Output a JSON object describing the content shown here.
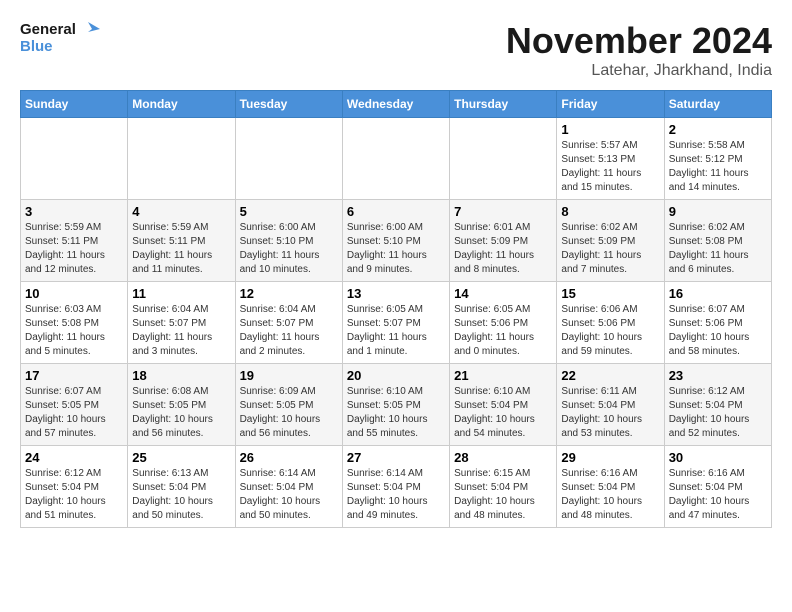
{
  "logo": {
    "line1": "General",
    "line2": "Blue"
  },
  "title": "November 2024",
  "location": "Latehar, Jharkhand, India",
  "days_of_week": [
    "Sunday",
    "Monday",
    "Tuesday",
    "Wednesday",
    "Thursday",
    "Friday",
    "Saturday"
  ],
  "weeks": [
    [
      {
        "day": "",
        "info": ""
      },
      {
        "day": "",
        "info": ""
      },
      {
        "day": "",
        "info": ""
      },
      {
        "day": "",
        "info": ""
      },
      {
        "day": "",
        "info": ""
      },
      {
        "day": "1",
        "info": "Sunrise: 5:57 AM\nSunset: 5:13 PM\nDaylight: 11 hours and 15 minutes."
      },
      {
        "day": "2",
        "info": "Sunrise: 5:58 AM\nSunset: 5:12 PM\nDaylight: 11 hours and 14 minutes."
      }
    ],
    [
      {
        "day": "3",
        "info": "Sunrise: 5:59 AM\nSunset: 5:11 PM\nDaylight: 11 hours and 12 minutes."
      },
      {
        "day": "4",
        "info": "Sunrise: 5:59 AM\nSunset: 5:11 PM\nDaylight: 11 hours and 11 minutes."
      },
      {
        "day": "5",
        "info": "Sunrise: 6:00 AM\nSunset: 5:10 PM\nDaylight: 11 hours and 10 minutes."
      },
      {
        "day": "6",
        "info": "Sunrise: 6:00 AM\nSunset: 5:10 PM\nDaylight: 11 hours and 9 minutes."
      },
      {
        "day": "7",
        "info": "Sunrise: 6:01 AM\nSunset: 5:09 PM\nDaylight: 11 hours and 8 minutes."
      },
      {
        "day": "8",
        "info": "Sunrise: 6:02 AM\nSunset: 5:09 PM\nDaylight: 11 hours and 7 minutes."
      },
      {
        "day": "9",
        "info": "Sunrise: 6:02 AM\nSunset: 5:08 PM\nDaylight: 11 hours and 6 minutes."
      }
    ],
    [
      {
        "day": "10",
        "info": "Sunrise: 6:03 AM\nSunset: 5:08 PM\nDaylight: 11 hours and 5 minutes."
      },
      {
        "day": "11",
        "info": "Sunrise: 6:04 AM\nSunset: 5:07 PM\nDaylight: 11 hours and 3 minutes."
      },
      {
        "day": "12",
        "info": "Sunrise: 6:04 AM\nSunset: 5:07 PM\nDaylight: 11 hours and 2 minutes."
      },
      {
        "day": "13",
        "info": "Sunrise: 6:05 AM\nSunset: 5:07 PM\nDaylight: 11 hours and 1 minute."
      },
      {
        "day": "14",
        "info": "Sunrise: 6:05 AM\nSunset: 5:06 PM\nDaylight: 11 hours and 0 minutes."
      },
      {
        "day": "15",
        "info": "Sunrise: 6:06 AM\nSunset: 5:06 PM\nDaylight: 10 hours and 59 minutes."
      },
      {
        "day": "16",
        "info": "Sunrise: 6:07 AM\nSunset: 5:06 PM\nDaylight: 10 hours and 58 minutes."
      }
    ],
    [
      {
        "day": "17",
        "info": "Sunrise: 6:07 AM\nSunset: 5:05 PM\nDaylight: 10 hours and 57 minutes."
      },
      {
        "day": "18",
        "info": "Sunrise: 6:08 AM\nSunset: 5:05 PM\nDaylight: 10 hours and 56 minutes."
      },
      {
        "day": "19",
        "info": "Sunrise: 6:09 AM\nSunset: 5:05 PM\nDaylight: 10 hours and 56 minutes."
      },
      {
        "day": "20",
        "info": "Sunrise: 6:10 AM\nSunset: 5:05 PM\nDaylight: 10 hours and 55 minutes."
      },
      {
        "day": "21",
        "info": "Sunrise: 6:10 AM\nSunset: 5:04 PM\nDaylight: 10 hours and 54 minutes."
      },
      {
        "day": "22",
        "info": "Sunrise: 6:11 AM\nSunset: 5:04 PM\nDaylight: 10 hours and 53 minutes."
      },
      {
        "day": "23",
        "info": "Sunrise: 6:12 AM\nSunset: 5:04 PM\nDaylight: 10 hours and 52 minutes."
      }
    ],
    [
      {
        "day": "24",
        "info": "Sunrise: 6:12 AM\nSunset: 5:04 PM\nDaylight: 10 hours and 51 minutes."
      },
      {
        "day": "25",
        "info": "Sunrise: 6:13 AM\nSunset: 5:04 PM\nDaylight: 10 hours and 50 minutes."
      },
      {
        "day": "26",
        "info": "Sunrise: 6:14 AM\nSunset: 5:04 PM\nDaylight: 10 hours and 50 minutes."
      },
      {
        "day": "27",
        "info": "Sunrise: 6:14 AM\nSunset: 5:04 PM\nDaylight: 10 hours and 49 minutes."
      },
      {
        "day": "28",
        "info": "Sunrise: 6:15 AM\nSunset: 5:04 PM\nDaylight: 10 hours and 48 minutes."
      },
      {
        "day": "29",
        "info": "Sunrise: 6:16 AM\nSunset: 5:04 PM\nDaylight: 10 hours and 48 minutes."
      },
      {
        "day": "30",
        "info": "Sunrise: 6:16 AM\nSunset: 5:04 PM\nDaylight: 10 hours and 47 minutes."
      }
    ]
  ]
}
